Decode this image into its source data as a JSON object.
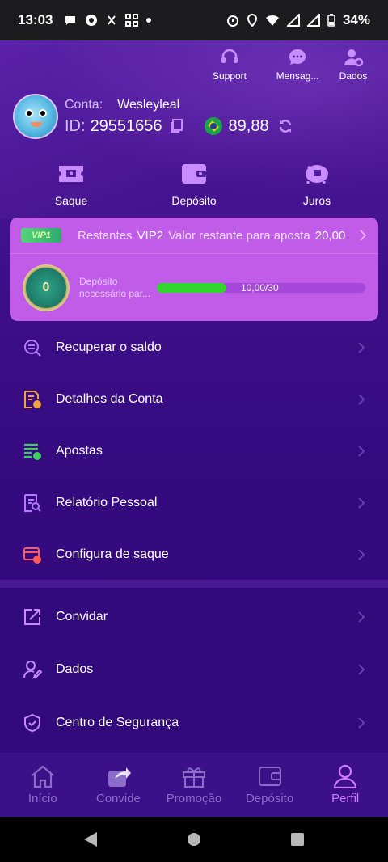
{
  "status_bar": {
    "time": "13:03",
    "battery": "34%",
    "left_icons": [
      "chat-bubble-icon",
      "chrome-icon",
      "sync-icon",
      "apps-icon",
      "dot-icon"
    ],
    "right_icons": [
      "alarm-icon",
      "location-icon",
      "wifi-icon",
      "signal-icon",
      "battery-icon"
    ]
  },
  "header": {
    "actions": [
      {
        "label": "Support",
        "icon": "headset-icon"
      },
      {
        "label": "Mensag...",
        "icon": "message-icon"
      },
      {
        "label": "Dados",
        "icon": "user-settings-icon"
      }
    ]
  },
  "profile": {
    "conta_label": "Conta:",
    "username": "Wesleyleal",
    "id_label": "ID:",
    "id_value": "29551656",
    "balance": "89,88"
  },
  "quick_actions": [
    {
      "label": "Saque",
      "icon": "ticket-icon"
    },
    {
      "label": "Depósito",
      "icon": "wallet-icon"
    },
    {
      "label": "Juros",
      "icon": "piggy-bank-icon"
    }
  ],
  "vip": {
    "badge": "VIP1",
    "restantes_label": "Restantes",
    "next_level": "VIP2",
    "desc": "Valor restante para aposta",
    "remaining_amount": "20,00",
    "coin_value": "0",
    "deposit_label": "Depósito necessário par...",
    "progress_text": "10,00/30",
    "progress_fraction": 0.333
  },
  "menu_primary": [
    {
      "label": "Recuperar o saldo",
      "icon": "recover-balance-icon",
      "color": "#b579ff"
    },
    {
      "label": "Detalhes da Conta",
      "icon": "account-details-icon",
      "color": "#f0a33a"
    },
    {
      "label": "Apostas",
      "icon": "bets-icon",
      "color": "#3ccf5c"
    },
    {
      "label": "Relatório Pessoal",
      "icon": "report-icon",
      "color": "#b579ff"
    },
    {
      "label": "Configura de saque",
      "icon": "withdraw-config-icon",
      "color": "#ff5a5a"
    }
  ],
  "menu_secondary": [
    {
      "label": "Convidar",
      "icon": "share-icon"
    },
    {
      "label": "Dados",
      "icon": "user-edit-icon"
    },
    {
      "label": "Centro de Segurança",
      "icon": "shield-icon"
    }
  ],
  "bottom_nav": [
    {
      "label": "Início",
      "icon": "home-icon",
      "active": false
    },
    {
      "label": "Convide",
      "icon": "share-arrow-icon",
      "active": false
    },
    {
      "label": "Promoção",
      "icon": "gift-icon",
      "active": false
    },
    {
      "label": "Depósito",
      "icon": "wallet-icon",
      "active": false
    },
    {
      "label": "Perfil",
      "icon": "profile-icon",
      "active": true
    }
  ],
  "colors": {
    "app_bg": "#3e0f8a",
    "vip_card": "#c05ce8",
    "progress_fill": "#32d62e",
    "nav_active": "#d17bff",
    "nav_inactive": "#8b6cc9"
  }
}
